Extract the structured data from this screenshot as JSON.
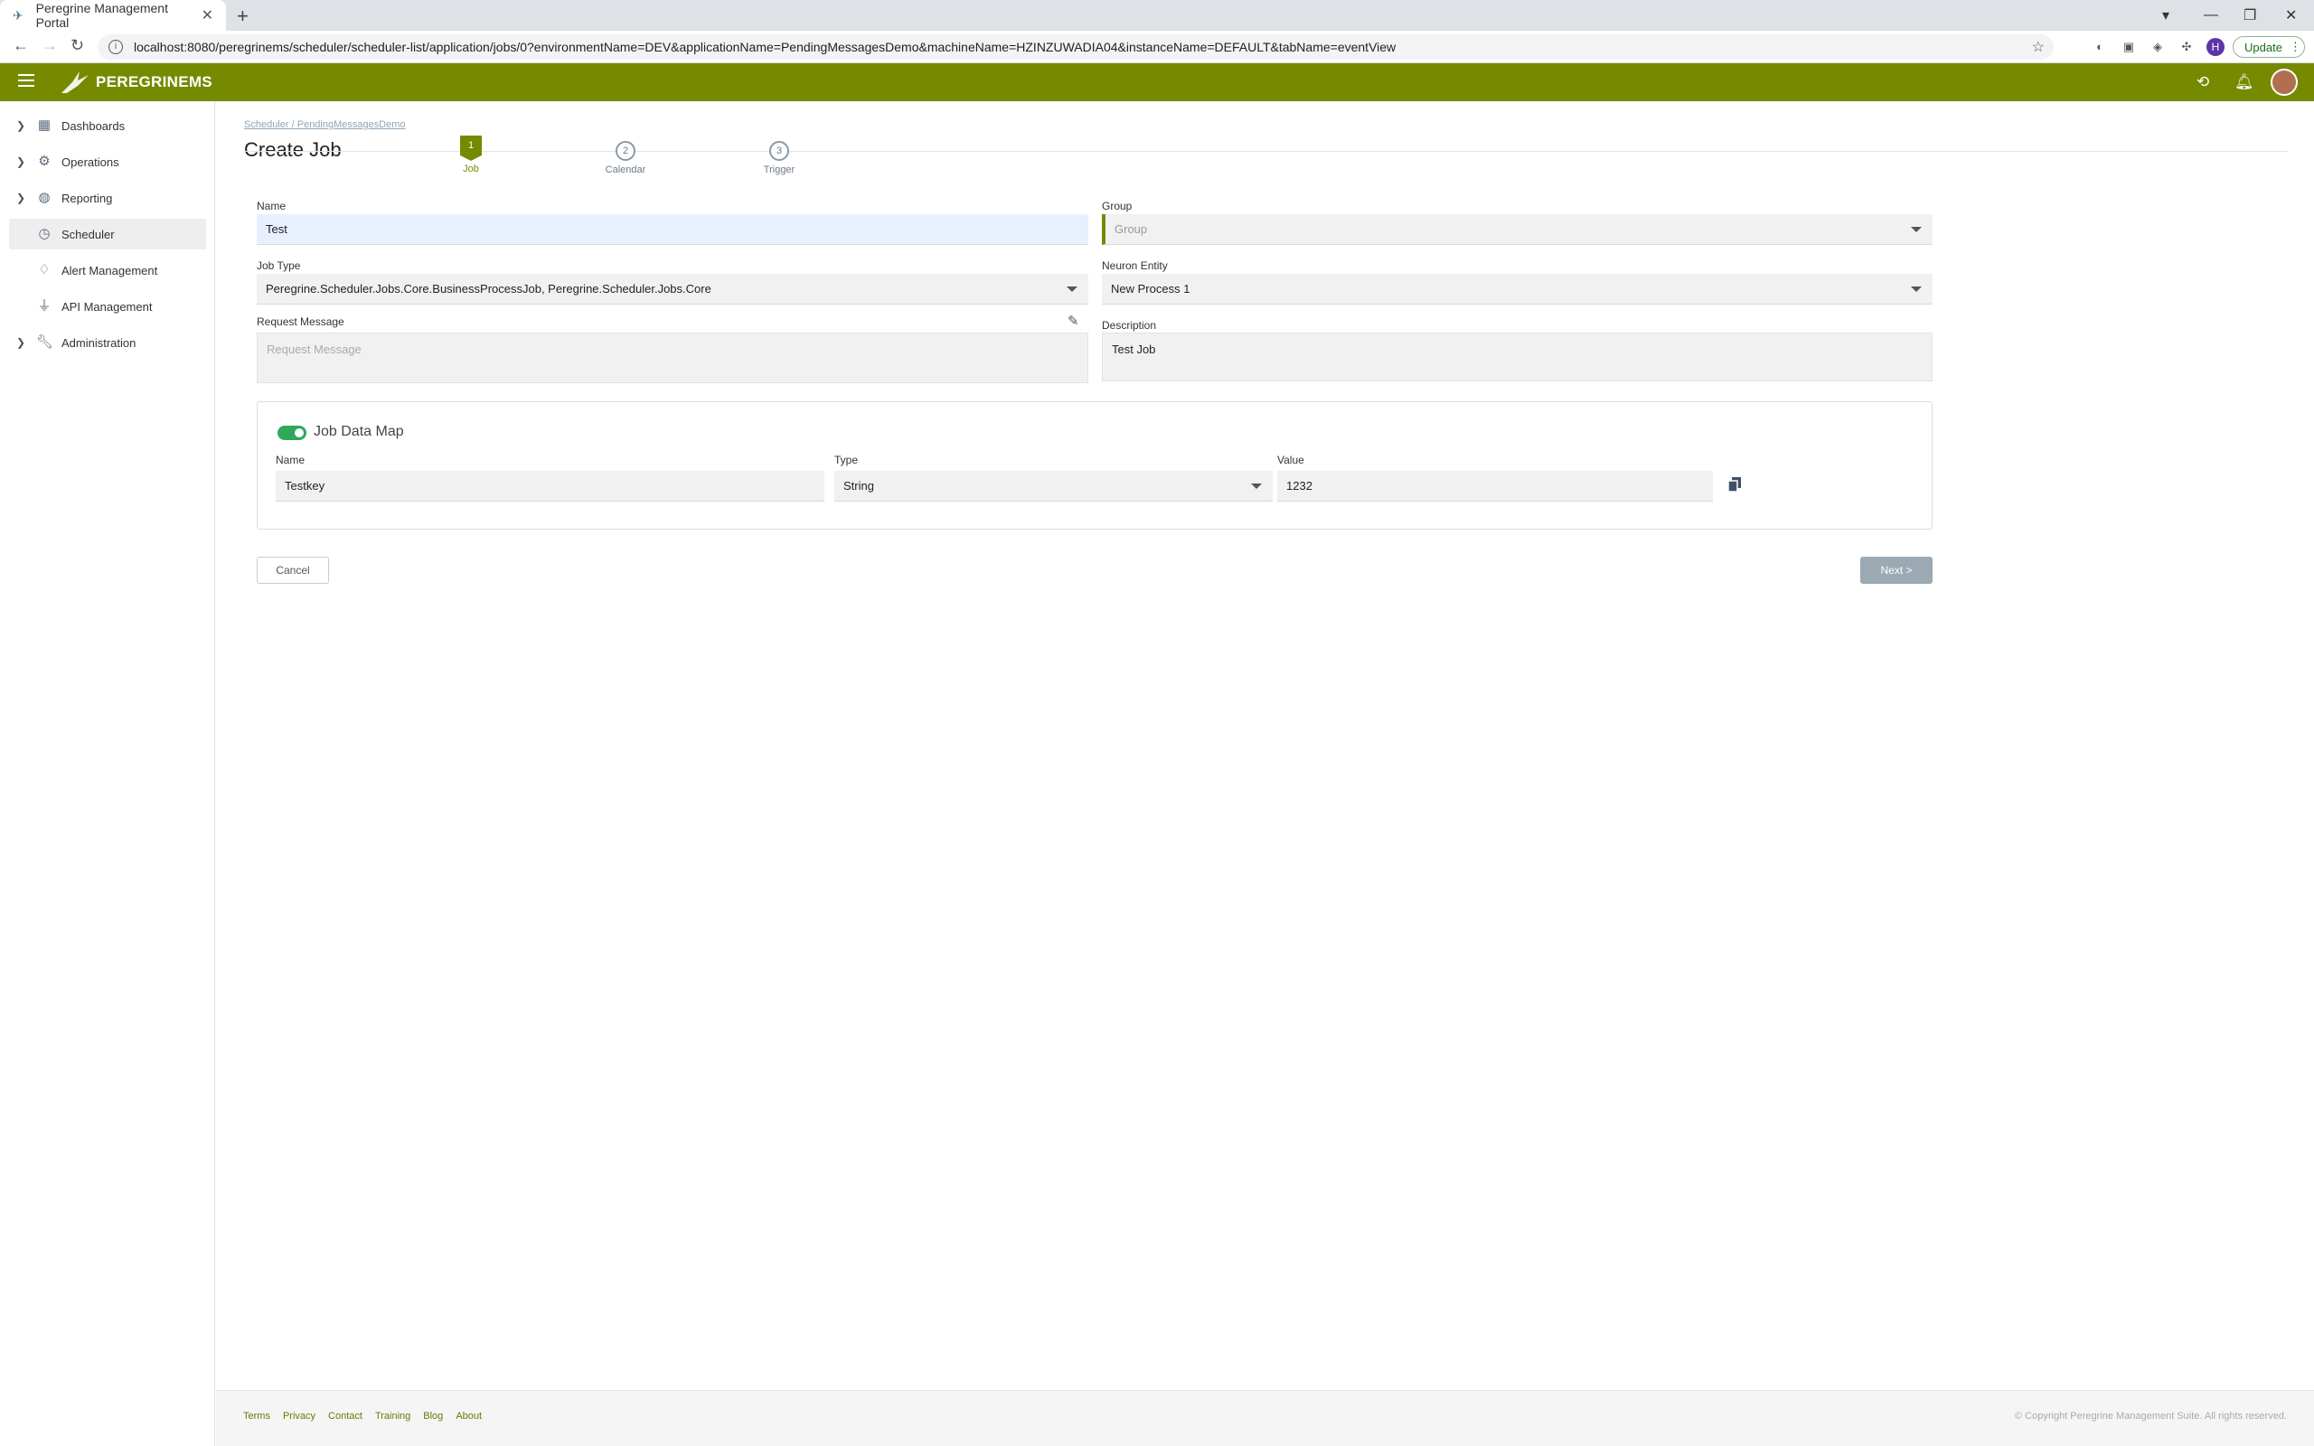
{
  "browser": {
    "tab_title": "Peregrine Management Portal",
    "url": "localhost:8080/peregrinems/scheduler/scheduler-list/application/jobs/0?environmentName=DEV&applicationName=PendingMessagesDemo&machineName=HZINZUWADIA04&instanceName=DEFAULT&tabName=eventView",
    "profile_initial": "H",
    "update_label": "Update"
  },
  "app": {
    "brand": "PEREGRINEMS",
    "accent": "#768a00"
  },
  "sidebar": {
    "items": [
      {
        "label": "Dashboards",
        "icon": "dashboard-icon"
      },
      {
        "label": "Operations",
        "icon": "gear-icon"
      },
      {
        "label": "Reporting",
        "icon": "globe-icon"
      },
      {
        "label": "Scheduler",
        "icon": "clock-icon"
      },
      {
        "label": "Alert Management",
        "icon": "bell-icon"
      },
      {
        "label": "API Management",
        "icon": "plug-icon"
      },
      {
        "label": "Administration",
        "icon": "wrench-icon"
      }
    ]
  },
  "breadcrumb": {
    "root": "Scheduler",
    "separator": "/",
    "current": "PendingMessagesDemo"
  },
  "page": {
    "title": "Create Job"
  },
  "steps": [
    {
      "num": "1",
      "label": "Job"
    },
    {
      "num": "2",
      "label": "Calendar"
    },
    {
      "num": "3",
      "label": "Trigger"
    }
  ],
  "form": {
    "name_label": "Name",
    "name_value": "Test",
    "group_label": "Group",
    "group_placeholder": "Group",
    "job_type_label": "Job Type",
    "job_type_value": "Peregrine.Scheduler.Jobs.Core.BusinessProcessJob, Peregrine.Scheduler.Jobs.Core",
    "neuron_entity_label": "Neuron Entity",
    "neuron_entity_value": "New Process 1",
    "request_message_label": "Request Message",
    "request_message_placeholder": "Request Message",
    "description_label": "Description",
    "description_value": "Test Job"
  },
  "job_data_map": {
    "title": "Job Data Map",
    "enabled": true,
    "name_label": "Name",
    "type_label": "Type",
    "value_label": "Value",
    "rows": [
      {
        "name": "Testkey",
        "type": "String",
        "value": "1232"
      }
    ]
  },
  "actions": {
    "cancel": "Cancel",
    "next": "Next >"
  },
  "footer": {
    "links": [
      "Terms",
      "Privacy",
      "Contact",
      "Training",
      "Blog",
      "About"
    ],
    "copyright": "© Copyright Peregrine Management Suite. All rights reserved."
  }
}
